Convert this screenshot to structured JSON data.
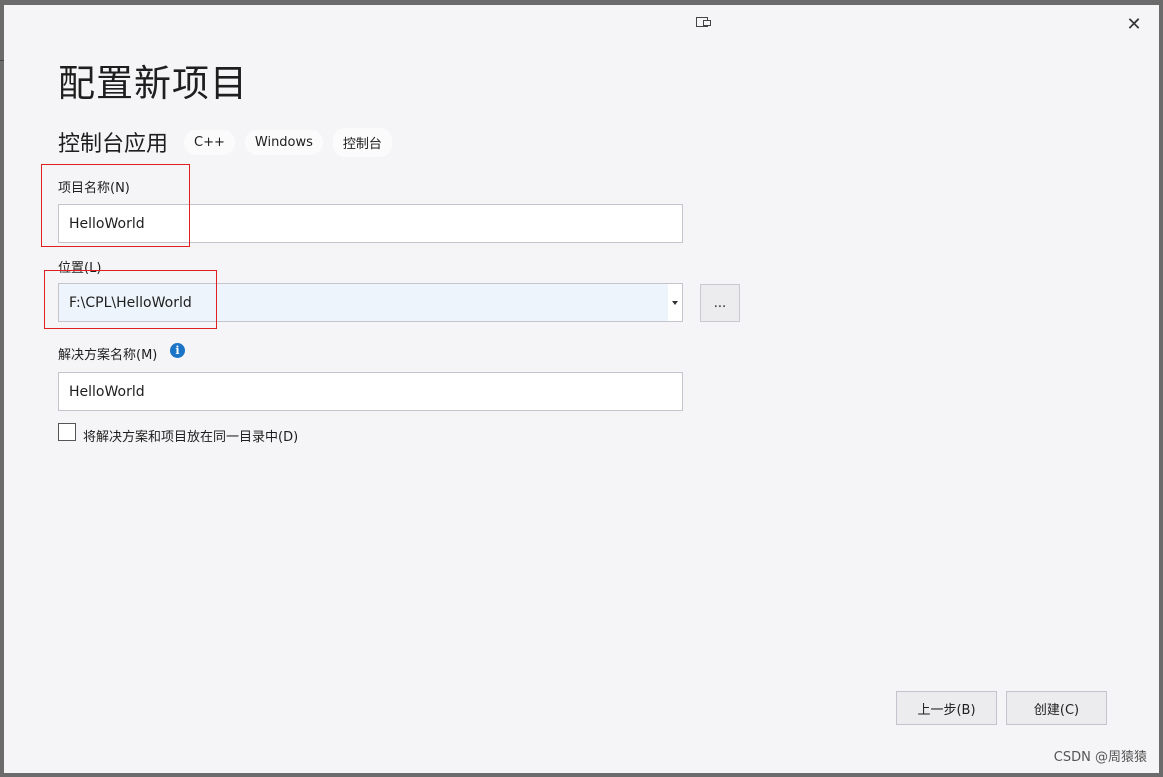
{
  "dialog": {
    "title": "配置新项目",
    "close_glyph": "✕",
    "title_bar_icon": "window-restore-icon"
  },
  "template": {
    "name": "控制台应用",
    "tags": [
      "C++",
      "Windows",
      "控制台"
    ]
  },
  "form": {
    "project_name": {
      "label": "项目名称(N)",
      "value": "HelloWorld"
    },
    "location": {
      "label": "位置(L)",
      "value": "F:\\CPL\\HelloWorld",
      "browse_label": "..."
    },
    "solution_name": {
      "label": "解决方案名称(M)",
      "value": "HelloWorld",
      "info_glyph": "i"
    },
    "same_directory": {
      "label": "将解决方案和项目放在同一目录中(D)",
      "checked": false
    }
  },
  "footer": {
    "back_label": "上一步(B)",
    "create_label": "创建(C)"
  },
  "watermark": "CSDN @周猿猿",
  "annotation_color": "#e02020"
}
